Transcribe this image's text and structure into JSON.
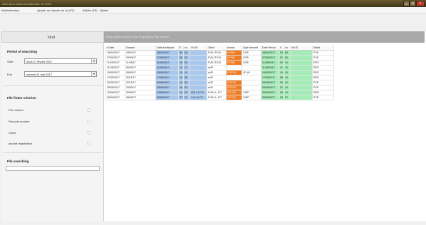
{
  "window": {
    "title": "Aide sans casse immatriculée vol 2019",
    "controls": {
      "minimize": "_",
      "maximize": "□",
      "close": "×"
    }
  },
  "menu": [
    "Administration",
    "Ajouter un dossier de vol (F2)",
    "Affiche (F5)",
    "Quitter"
  ],
  "sidebar": {
    "header": "Find",
    "period_title": "Period of searching",
    "start_label": "Start",
    "start_value": "lundi  27  février  2017",
    "end_label": "End",
    "end_value": "samedi  24  mai  2017",
    "file_title": "File finder criterion",
    "criteria": [
      "File number",
      "Request number",
      "Client",
      "aircraft registration"
    ],
    "search_title": "File searching"
  },
  "info_bar": "Drop column header here to group by that column",
  "table": {
    "columns": [
      "# Date",
      "Dossier",
      "Date Arr/départ",
      "S",
      "no.",
      "Vol ID",
      "Client",
      "Immat",
      "Type aéronef",
      "Date Retour",
      "S",
      "no.",
      "Vol ID",
      "Statut"
    ],
    "rows": [
      [
        "18/04/2017",
        "18/04/17",
        "18/04/2017",
        "80",
        "03",
        "",
        "FVD-ITV10",
        "N7860",
        "G2/5",
        "18/04/2017",
        "03",
        "80",
        "",
        "PVE"
      ],
      [
        "07/05/2017",
        "05/05/17",
        "07/05/2017",
        "80",
        "02",
        "",
        "FVD-ITV10",
        "N7860",
        "G2/5",
        "07/05/2017",
        "02",
        "80",
        "",
        "PVE"
      ],
      [
        "11/05/2017",
        "11/05/17",
        "11/05/2017",
        "10",
        "93",
        "",
        "FVD-ITV10",
        "N7860",
        "G2/5",
        "11/05/2017",
        "93",
        "10",
        "",
        "REG"
      ],
      [
        "11/05/2017",
        "05/05/17",
        "11/05/2017",
        "10",
        "21",
        "",
        "aVR",
        "",
        "",
        "11/05/2017",
        "21",
        "10",
        "",
        "REG"
      ],
      [
        "15/05/2017",
        "05/05/17",
        "15/05/2017",
        "10",
        "19",
        "",
        "aVR",
        "FGFYO",
        "LP-45",
        "15/05/2017",
        "19",
        "10",
        "",
        "REG"
      ],
      [
        "17/05/2017",
        "30/11/17",
        "17/05/2017",
        "10",
        "58",
        "",
        "aVR",
        "",
        "",
        "17/05/2017",
        "58",
        "10",
        "",
        "REG"
      ],
      [
        "20/05/2017",
        "20/11/17",
        "20/05/2017",
        "10",
        "53",
        "",
        "aVR",
        "GCEC0",
        "",
        "20/05/2017",
        "53",
        "10",
        "",
        "PVE"
      ],
      [
        "25/05/2017",
        "25/05/17",
        "25/05/2017",
        "10",
        "32",
        "",
        "aVR",
        "GCEC0",
        "",
        "25/05/2017",
        "32",
        "10",
        "",
        "PVE"
      ],
      [
        "19/06/2017",
        "30/06/17",
        "19/06/2017",
        "14",
        "03",
        "LTA 7,8 7,9",
        "FVD-LL-CIT",
        "GCYAC",
        "C/RP",
        "30/06/2017",
        "03",
        "14",
        "",
        "REG"
      ],
      [
        "05/06/2017",
        "05/06/17",
        "05/06/2017",
        "07",
        "03",
        "1,8 1,9 7,9",
        "FVD-LL-CIT",
        "GCYAC",
        "C/RP",
        "05/06/2017",
        "03",
        "07",
        "",
        "PVE"
      ]
    ]
  },
  "colors": {
    "titlebar": "#4a3d1f",
    "blue": "#a8c8ee",
    "green": "#a3ecb6",
    "orange": "#f07a20",
    "infobar": "#a9a9a9"
  }
}
